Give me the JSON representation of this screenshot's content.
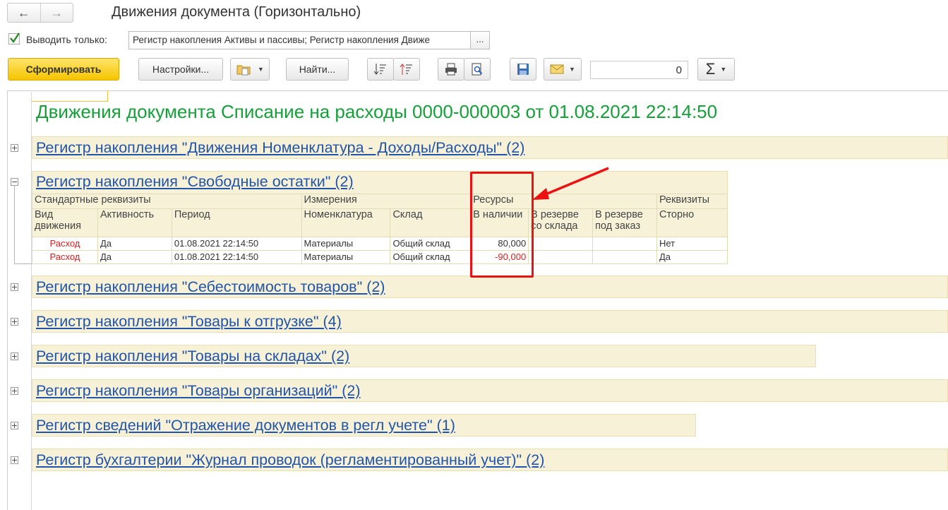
{
  "window": {
    "title": "Движения документа (Горизонтально)",
    "back_icon": "←",
    "forward_icon": "→"
  },
  "filter": {
    "checkbox_checked": true,
    "label": "Выводить только:",
    "value": "Регистр накопления Активы и пассивы; Регистр накопления Движе",
    "select_button": "..."
  },
  "toolbar": {
    "generate_label": "Сформировать",
    "settings_label": "Настройки...",
    "find_label": "Найти...",
    "counter_value": "0",
    "sum_icon": "Σ"
  },
  "report": {
    "doc_title": "Движения документа Списание на расходы 0000-000003 от 01.08.2021 22:14:50",
    "registers": [
      {
        "label": "Регистр накопления \"Движения Номенклатура - Доходы/Расходы\" (2)",
        "expanded": false
      },
      {
        "label": "Регистр накопления \"Свободные остатки\" (2)",
        "expanded": true
      },
      {
        "label": "Регистр накопления \"Себестоимость товаров\" (2)",
        "expanded": false
      },
      {
        "label": "Регистр накопления \"Товары к отгрузке\" (4)",
        "expanded": false
      },
      {
        "label": "Регистр накопления \"Товары на складах\" (2)",
        "expanded": false
      },
      {
        "label": "Регистр накопления \"Товары организаций\" (2)",
        "expanded": false
      },
      {
        "label": "Регистр сведений \"Отражение документов в регл учете\" (1)",
        "expanded": false
      },
      {
        "label": "Регистр бухгалтерии \"Журнал проводок (регламентированный учет)\" (2)",
        "expanded": false
      }
    ],
    "table": {
      "groups": {
        "standard": "Стандартные реквизиты",
        "dimensions": "Измерения",
        "resources": "Ресурсы",
        "attributes": "Реквизиты"
      },
      "columns": {
        "movement_type": "Вид движения",
        "activity": "Активность",
        "period": "Период",
        "nomenclature": "Номенклатура",
        "warehouse": "Склад",
        "available": "В наличии",
        "reserve_warehouse": "В резерве со склада",
        "reserve_order": "В резерве под заказ",
        "storno": "Сторно"
      },
      "rows": [
        {
          "movement_type": "Расход",
          "activity": "Да",
          "period": "01.08.2021 22:14:50",
          "nomenclature": "Материалы",
          "warehouse": "Общий склад",
          "available": "80,000",
          "reserve_warehouse": "",
          "reserve_order": "",
          "storno": "Нет"
        },
        {
          "movement_type": "Расход",
          "activity": "Да",
          "period": "01.08.2021 22:14:50",
          "nomenclature": "Материалы",
          "warehouse": "Общий склад",
          "available": "-90,000",
          "reserve_warehouse": "",
          "reserve_order": "",
          "storno": "Да"
        }
      ]
    }
  },
  "colors": {
    "title_green": "#16a03a",
    "link_blue": "#2255aa",
    "band_beige": "#f7f1d8",
    "highlight_red": "#ee1111",
    "primary_yellow": "#f5c400"
  }
}
